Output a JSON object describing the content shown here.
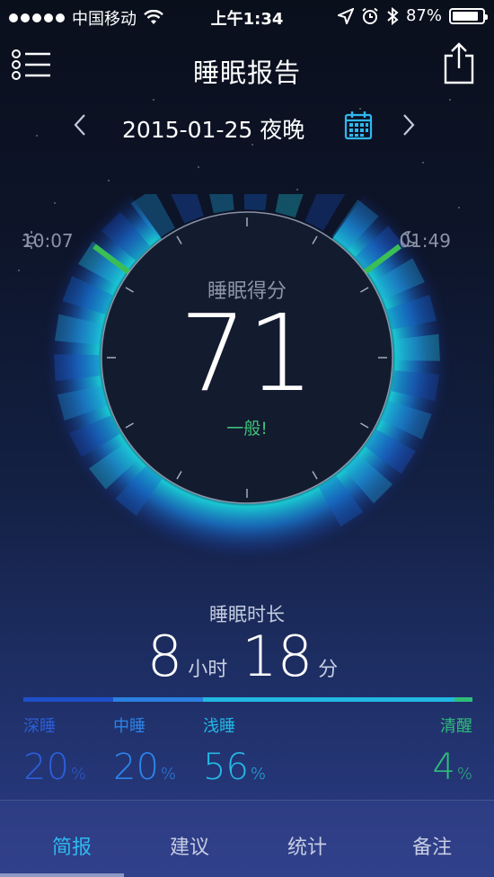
{
  "status_bar": {
    "carrier": "中国移动",
    "time": "上午1:34",
    "battery": "87%",
    "battery_level": 0.87
  },
  "header": {
    "title": "睡眠报告"
  },
  "date_nav": {
    "date": "2015-01-25 夜晚"
  },
  "dial": {
    "start_time": "10:07",
    "end_time": "01:49",
    "score_title": "睡眠得分",
    "score": "71",
    "rating": "一般!"
  },
  "duration": {
    "title": "睡眠时长",
    "hours": "8",
    "hours_unit": "小时",
    "minutes": "18",
    "minutes_unit": "分"
  },
  "stages": [
    {
      "name": "深睡",
      "value": "20",
      "unit": "%",
      "fraction": 0.2,
      "color": "#1f4fc9"
    },
    {
      "name": "中睡",
      "value": "20",
      "unit": "%",
      "fraction": 0.2,
      "color": "#2a7fe0"
    },
    {
      "name": "浅睡",
      "value": "56",
      "unit": "%",
      "fraction": 0.56,
      "color": "#22b8e2"
    },
    {
      "name": "清醒",
      "value": "4",
      "unit": "%",
      "fraction": 0.04,
      "color": "#2fbe7a"
    }
  ],
  "tabs": [
    {
      "label": "简报",
      "active": true
    },
    {
      "label": "建议",
      "active": false
    },
    {
      "label": "统计",
      "active": false
    },
    {
      "label": "备注",
      "active": false
    }
  ],
  "colors": {
    "accent": "#2fb8ef",
    "rating": "#3fbf7a"
  }
}
